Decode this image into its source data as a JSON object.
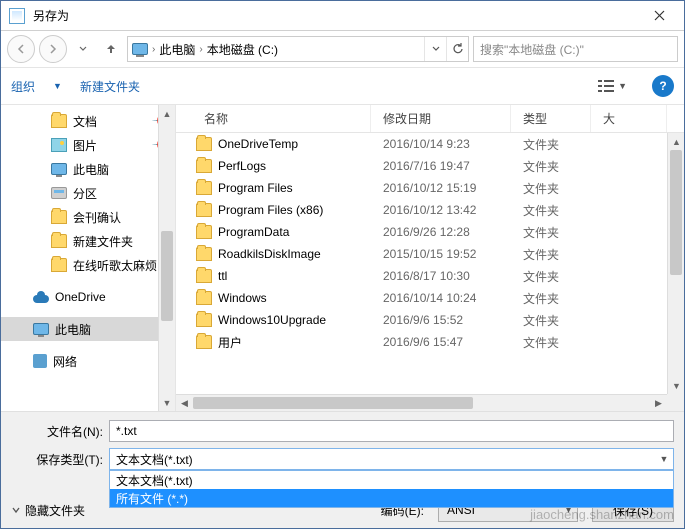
{
  "title": "另存为",
  "breadcrumbs": {
    "root": "此电脑",
    "drive": "本地磁盘 (C:)"
  },
  "search": {
    "placeholder": "搜索\"本地磁盘 (C:)\""
  },
  "toolbar": {
    "organize": "组织",
    "new_folder": "新建文件夹"
  },
  "tree": {
    "documents": "文档",
    "pictures": "图片",
    "this_pc": "此电脑",
    "partition": "分区",
    "hk": "会刊确认",
    "new_folder": "新建文件夹",
    "online": "在线听歌太麻烦",
    "onedrive": "OneDrive",
    "this_pc2": "此电脑",
    "network": "网络"
  },
  "columns": {
    "name": "名称",
    "date": "修改日期",
    "type": "类型",
    "size": "大"
  },
  "type_folder": "文件夹",
  "files": [
    {
      "name": "OneDriveTemp",
      "date": "2016/10/14 9:23"
    },
    {
      "name": "PerfLogs",
      "date": "2016/7/16 19:47"
    },
    {
      "name": "Program Files",
      "date": "2016/10/12 15:19"
    },
    {
      "name": "Program Files (x86)",
      "date": "2016/10/12 13:42"
    },
    {
      "name": "ProgramData",
      "date": "2016/9/26 12:28"
    },
    {
      "name": "RoadkilsDiskImage",
      "date": "2015/10/15 19:52"
    },
    {
      "name": "ttl",
      "date": "2016/8/17 10:30"
    },
    {
      "name": "Windows",
      "date": "2016/10/14 10:24"
    },
    {
      "name": "Windows10Upgrade",
      "date": "2016/9/6 15:52"
    },
    {
      "name": "用户",
      "date": "2016/9/6 15:47"
    }
  ],
  "filename": {
    "label": "文件名(N):",
    "value": "*.txt"
  },
  "filetype": {
    "label": "保存类型(T):",
    "selected": "文本文档(*.txt)",
    "opt0": "文本文档(*.txt)",
    "opt1": "所有文件 (*.*)"
  },
  "hide_folders": "隐藏文件夹",
  "encoding": {
    "label": "编码(E):",
    "value": "ANSI"
  },
  "save_btn": "保存(S)",
  "watermark": "jiaocheng.shanzhan.com"
}
